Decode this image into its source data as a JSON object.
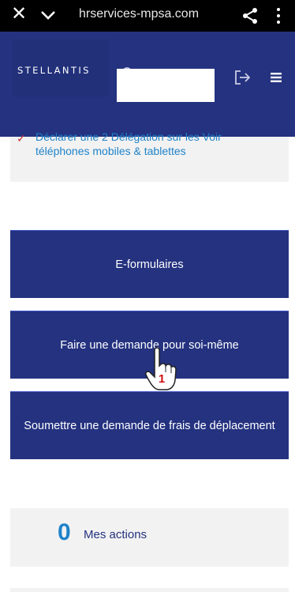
{
  "browser": {
    "url": "hrservices-mpsa.com",
    "close_icon": "close-icon",
    "chevron_icon": "chevron-down-icon",
    "share_icon": "share-icon",
    "menu_icon": "more-vert-icon"
  },
  "header": {
    "logo_text": "STELLANTIS",
    "user_icon": "user-icon",
    "user_name": "",
    "logout_icon": "logout-icon",
    "menu_icon": "hamburger-menu-icon",
    "color": "#24327f"
  },
  "top_card": {
    "partial_line": "Déclarer une 2 Délégation sur les    Voir",
    "line2": "téléphones mobiles & tablettes"
  },
  "buttons": [
    {
      "label": "E-formulaires"
    },
    {
      "label": "Faire une demande pour soi-même"
    },
    {
      "label": "Soumettre une demande de frais de déplacement"
    }
  ],
  "cursor": {
    "number": "1"
  },
  "actions": {
    "count": "0",
    "label": "Mes actions"
  }
}
